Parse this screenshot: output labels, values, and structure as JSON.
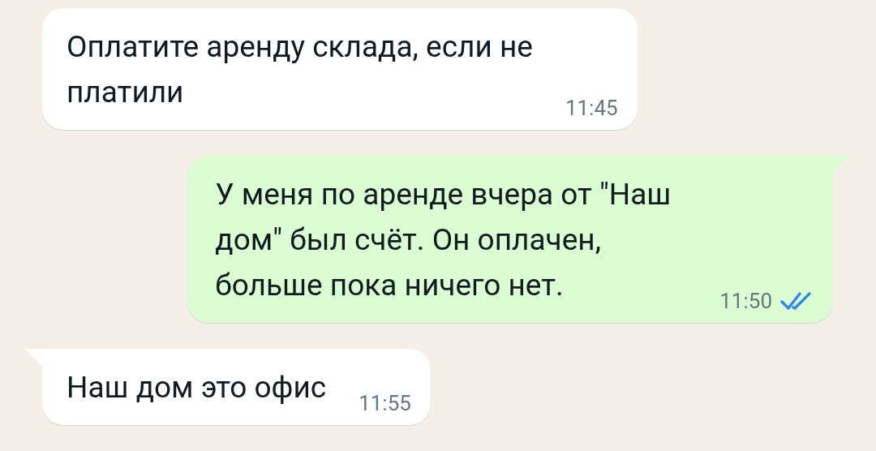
{
  "messages": [
    {
      "kind": "incoming",
      "tail": false,
      "text": "Оплатите аренду склада, если не\nплатили",
      "time": "11:45"
    },
    {
      "kind": "outgoing",
      "tail": true,
      "text": "У меня по аренде вчера от \"Наш\nдом\" был счёт. Он оплачен,\nбольше пока ничего нет.",
      "time": "11:50",
      "read": true
    },
    {
      "kind": "incoming",
      "tail": true,
      "text": "Наш дом это офис",
      "time": "11:55"
    }
  ]
}
